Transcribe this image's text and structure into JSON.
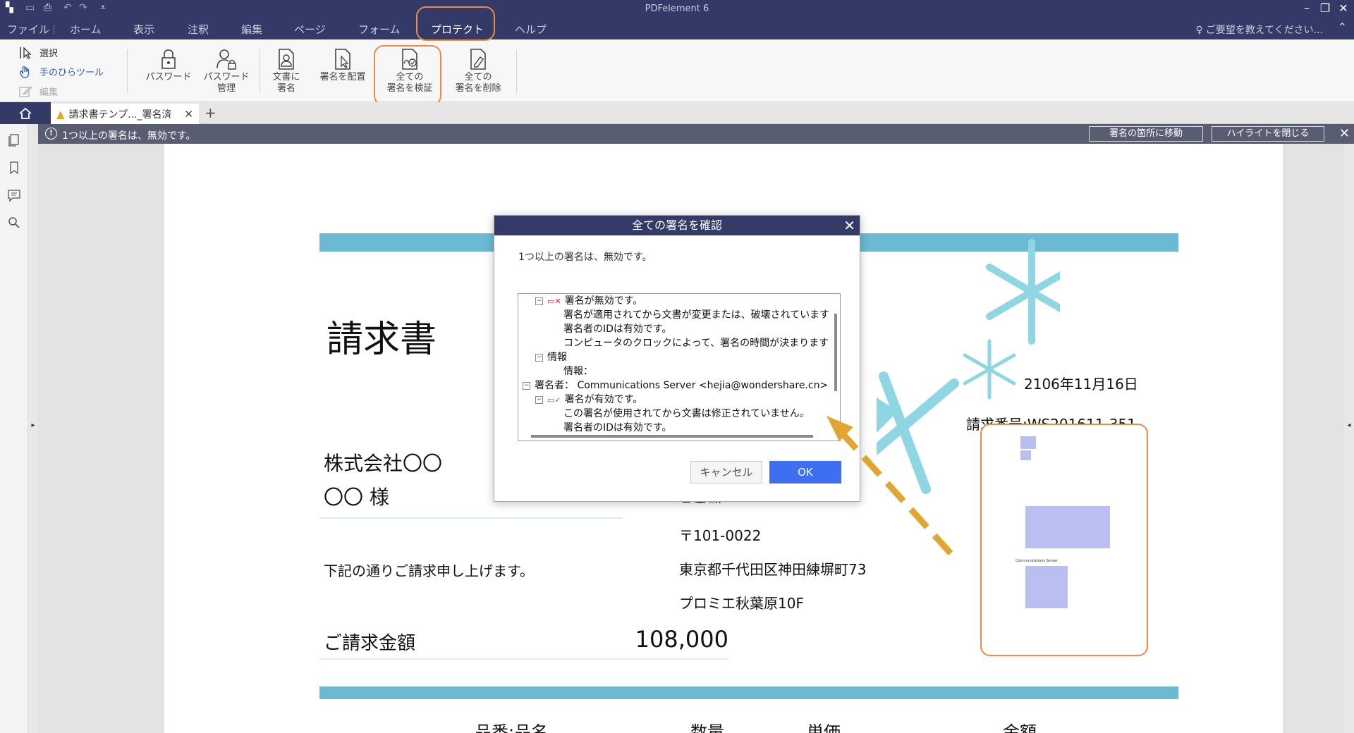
{
  "window": {
    "title": "PDFelement 6"
  },
  "menu": {
    "items": [
      "ファイル",
      "ホーム",
      "表示",
      "注釈",
      "編集",
      "ページ",
      "フォーム",
      "プロテクト",
      "ヘルプ"
    ],
    "active": "プロテクト",
    "feedback": "ご要望を教えてください..."
  },
  "ribbon": {
    "tools": {
      "select": "選択",
      "hand": "手のひらツール",
      "edit": "編集"
    },
    "buttons": [
      {
        "line1": "パスワード",
        "line2": ""
      },
      {
        "line1": "パスワード",
        "line2": "管理"
      },
      {
        "line1": "文書に",
        "line2": "署名"
      },
      {
        "line1": "署名を配置",
        "line2": ""
      },
      {
        "line1": "全ての",
        "line2": "署名を検証"
      },
      {
        "line1": "全ての",
        "line2": "署名を削除"
      }
    ]
  },
  "tabs": {
    "document": "請求書テンプ..._署名済"
  },
  "notification": {
    "message": "1つ以上の署名は、無効です。",
    "goto_button": "署名の箇所に移動",
    "close_highlight_button": "ハイライトを閉じる"
  },
  "document": {
    "title": "請求書",
    "company": "株式会社〇〇",
    "customer": "〇〇 様",
    "greeting": "下記の通りご請求申し上げます。",
    "amount_label": "ご請求金額",
    "amount_value": "108,000",
    "date": "2106年11月16日",
    "invoice_no": "請求番号:WS201611-351",
    "dept": "営業部",
    "postal": "〒101-0022",
    "address": "東京都千代田区神田練塀町73",
    "building": "プロミエ秋葉原10F",
    "columns": [
      "品番:品名",
      "数量",
      "単価",
      "金額"
    ],
    "sig_caption": "Communications Server"
  },
  "dialog": {
    "title": "全ての署名を確認",
    "message": "1つ以上の署名は、無効です。",
    "tree": [
      {
        "toggle": "⊟",
        "icon": "invalid",
        "text": "署名が無効です。"
      },
      {
        "toggle": "",
        "icon": "",
        "text": "署名が適用されてから文書が変更または、破壊されています"
      },
      {
        "toggle": "",
        "icon": "",
        "text": "署名者のIDは有効です。"
      },
      {
        "toggle": "",
        "icon": "",
        "text": "コンピュータのクロックによって、署名の時間が決まります"
      },
      {
        "toggle": "⊟",
        "icon": "",
        "text": "情報"
      },
      {
        "toggle": "",
        "icon": "",
        "text": "情報："
      },
      {
        "toggle": "⊟",
        "icon": "",
        "text": "署名者： Communications Server <hejia@wondershare.cn>"
      },
      {
        "toggle": "⊟",
        "icon": "valid",
        "text": "署名が有効です。"
      },
      {
        "toggle": "",
        "icon": "",
        "text": "この署名が使用されてから文書は修正されていません。"
      },
      {
        "toggle": "",
        "icon": "",
        "text": "署名者のIDは有効です。"
      }
    ],
    "cancel": "キャンセル",
    "ok": "OK"
  },
  "colors": {
    "titlebar": "#343a68",
    "accent_orange": "#f08a45",
    "ok_button": "#3d6ff0",
    "band": "#6bb9d2",
    "snowflake": "#8fd6e3"
  }
}
